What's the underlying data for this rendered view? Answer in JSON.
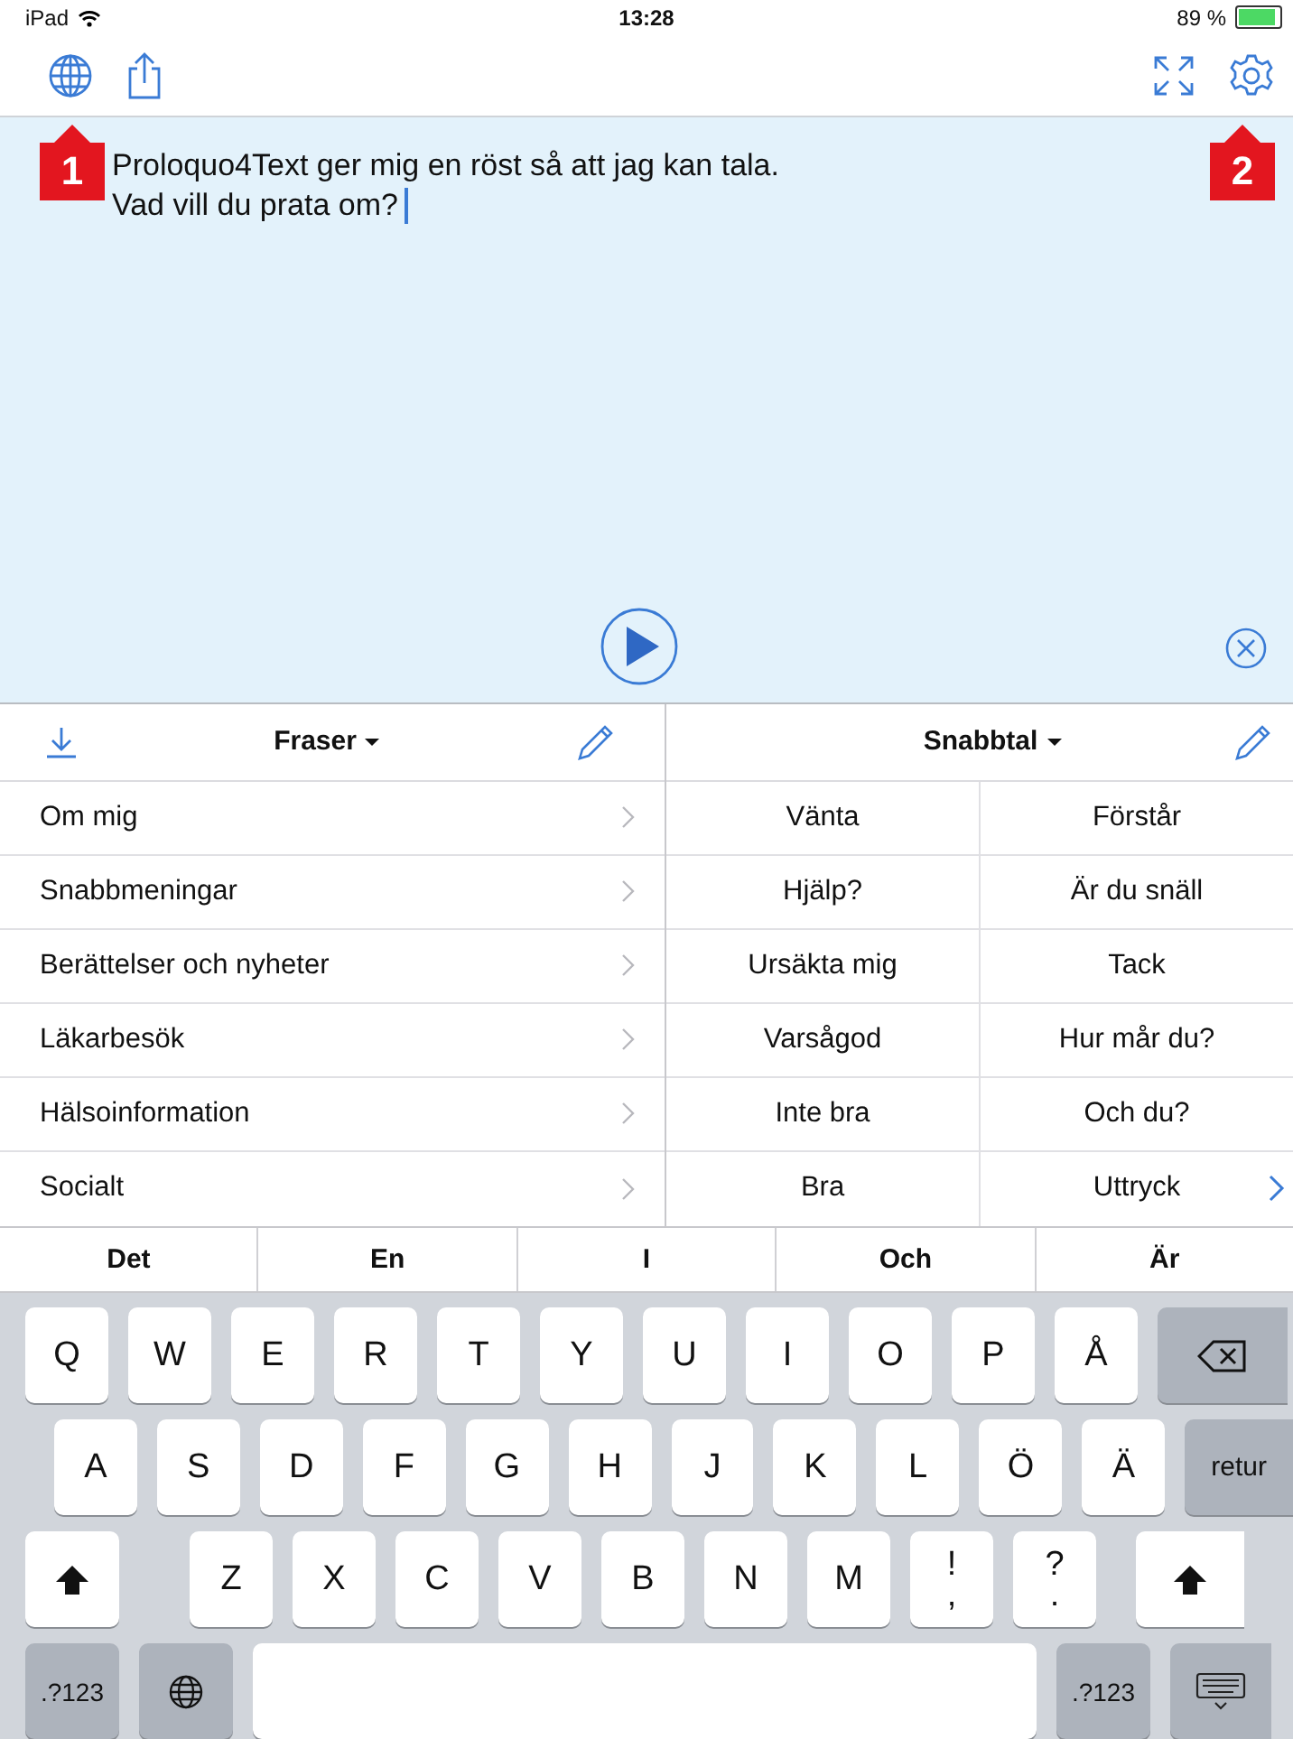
{
  "status_bar": {
    "device": "iPad",
    "time": "13:28",
    "battery": "89 %"
  },
  "callouts": [
    {
      "number": "1"
    },
    {
      "number": "2"
    }
  ],
  "message": {
    "lines": [
      "Proloquo4Text ger mig en röst så att jag kan tala.",
      "Vad vill du prata om?"
    ]
  },
  "phrases": {
    "title": "Fraser",
    "items": [
      "Om mig",
      "Snabbmeningar",
      "Berättelser och nyheter",
      "Läkarbesök",
      "Hälsoinformation",
      "Socialt"
    ]
  },
  "quick": {
    "title": "Snabbtal",
    "items": [
      "Vänta",
      "Förstår",
      "Hjälp?",
      "Är du snäll",
      "Ursäkta mig",
      "Tack",
      "Varsågod",
      "Hur mår du?",
      "Inte bra",
      "Och du?",
      "Bra",
      "Uttryck"
    ]
  },
  "suggestions": [
    "Det",
    "En",
    "I",
    "Och",
    "Är"
  ],
  "keyboard": [
    [
      {
        "kind": "char",
        "label": "Q"
      },
      {
        "kind": "char",
        "label": "W"
      },
      {
        "kind": "char",
        "label": "E"
      },
      {
        "kind": "char",
        "label": "R"
      },
      {
        "kind": "char",
        "label": "T"
      },
      {
        "kind": "char",
        "label": "Y"
      },
      {
        "kind": "char",
        "label": "U"
      },
      {
        "kind": "char",
        "label": "I"
      },
      {
        "kind": "char",
        "label": "O"
      },
      {
        "kind": "char",
        "label": "P"
      },
      {
        "kind": "char",
        "label": "Å"
      },
      {
        "kind": "backspace"
      }
    ],
    [
      {
        "kind": "char",
        "label": "A"
      },
      {
        "kind": "char",
        "label": "S"
      },
      {
        "kind": "char",
        "label": "D"
      },
      {
        "kind": "char",
        "label": "F"
      },
      {
        "kind": "char",
        "label": "G"
      },
      {
        "kind": "char",
        "label": "H"
      },
      {
        "kind": "char",
        "label": "J"
      },
      {
        "kind": "char",
        "label": "K"
      },
      {
        "kind": "char",
        "label": "L"
      },
      {
        "kind": "char",
        "label": "Ö"
      },
      {
        "kind": "char",
        "label": "Ä"
      },
      {
        "kind": "return",
        "label": "retur"
      }
    ],
    [
      {
        "kind": "shift"
      },
      {
        "kind": "char",
        "label": "Z"
      },
      {
        "kind": "char",
        "label": "X"
      },
      {
        "kind": "char",
        "label": "C"
      },
      {
        "kind": "char",
        "label": "V"
      },
      {
        "kind": "char",
        "label": "B"
      },
      {
        "kind": "char",
        "label": "N"
      },
      {
        "kind": "char",
        "label": "M"
      },
      {
        "kind": "dual",
        "label": "!",
        "sub": ","
      },
      {
        "kind": "dual",
        "label": "?",
        "sub": "."
      },
      {
        "kind": "shift"
      }
    ],
    [
      {
        "kind": "mode",
        "label": ".?123"
      },
      {
        "kind": "globe"
      },
      {
        "kind": "space"
      },
      {
        "kind": "mode",
        "label": ".?123"
      },
      {
        "kind": "hide"
      }
    ]
  ]
}
